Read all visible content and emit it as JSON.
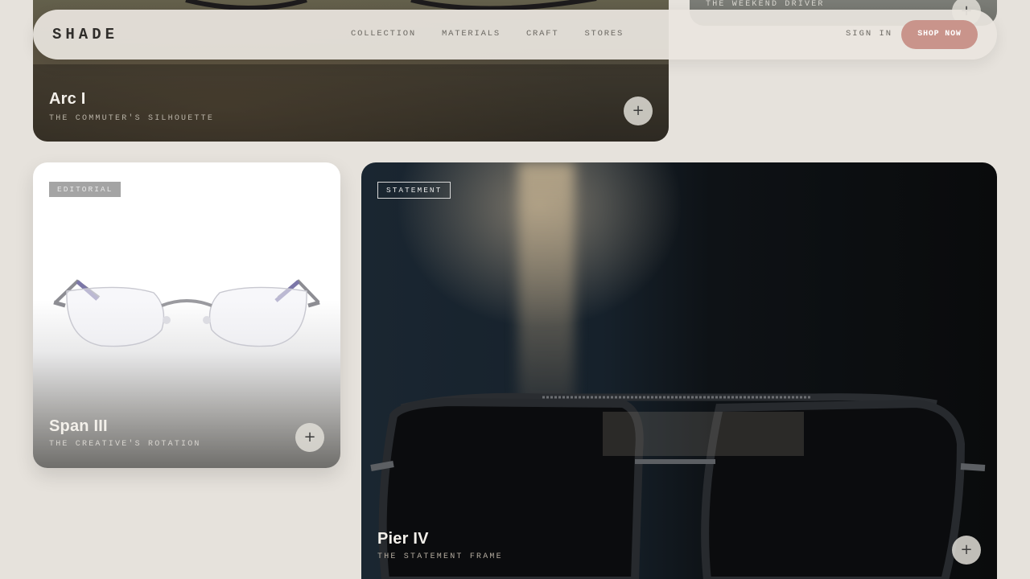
{
  "nav": {
    "logo": "SHADE",
    "links": [
      "COLLECTION",
      "MATERIALS",
      "CRAFT",
      "STORES"
    ],
    "sign_in": "SIGN IN",
    "shop_now": "SHOP NOW"
  },
  "cards": {
    "arc": {
      "title": "Arc I",
      "subtitle": "THE COMMUTER'S SILHOUETTE",
      "plus": "+"
    },
    "weekend": {
      "subtitle": "THE WEEKEND DRIVER",
      "plus": "+"
    },
    "span": {
      "tag": "EDITORIAL",
      "title": "Span III",
      "subtitle": "THE CREATIVE'S ROTATION",
      "plus": "+"
    },
    "pier": {
      "tag": "STATEMENT",
      "title": "Pier IV",
      "subtitle": "THE STATEMENT FRAME",
      "plus": "+"
    }
  },
  "colors": {
    "background": "#e6e2dc",
    "accent": "#c9948b"
  },
  "icons": [
    "plus-icon",
    "rimless-glasses-image",
    "aviator-glasses-image"
  ]
}
